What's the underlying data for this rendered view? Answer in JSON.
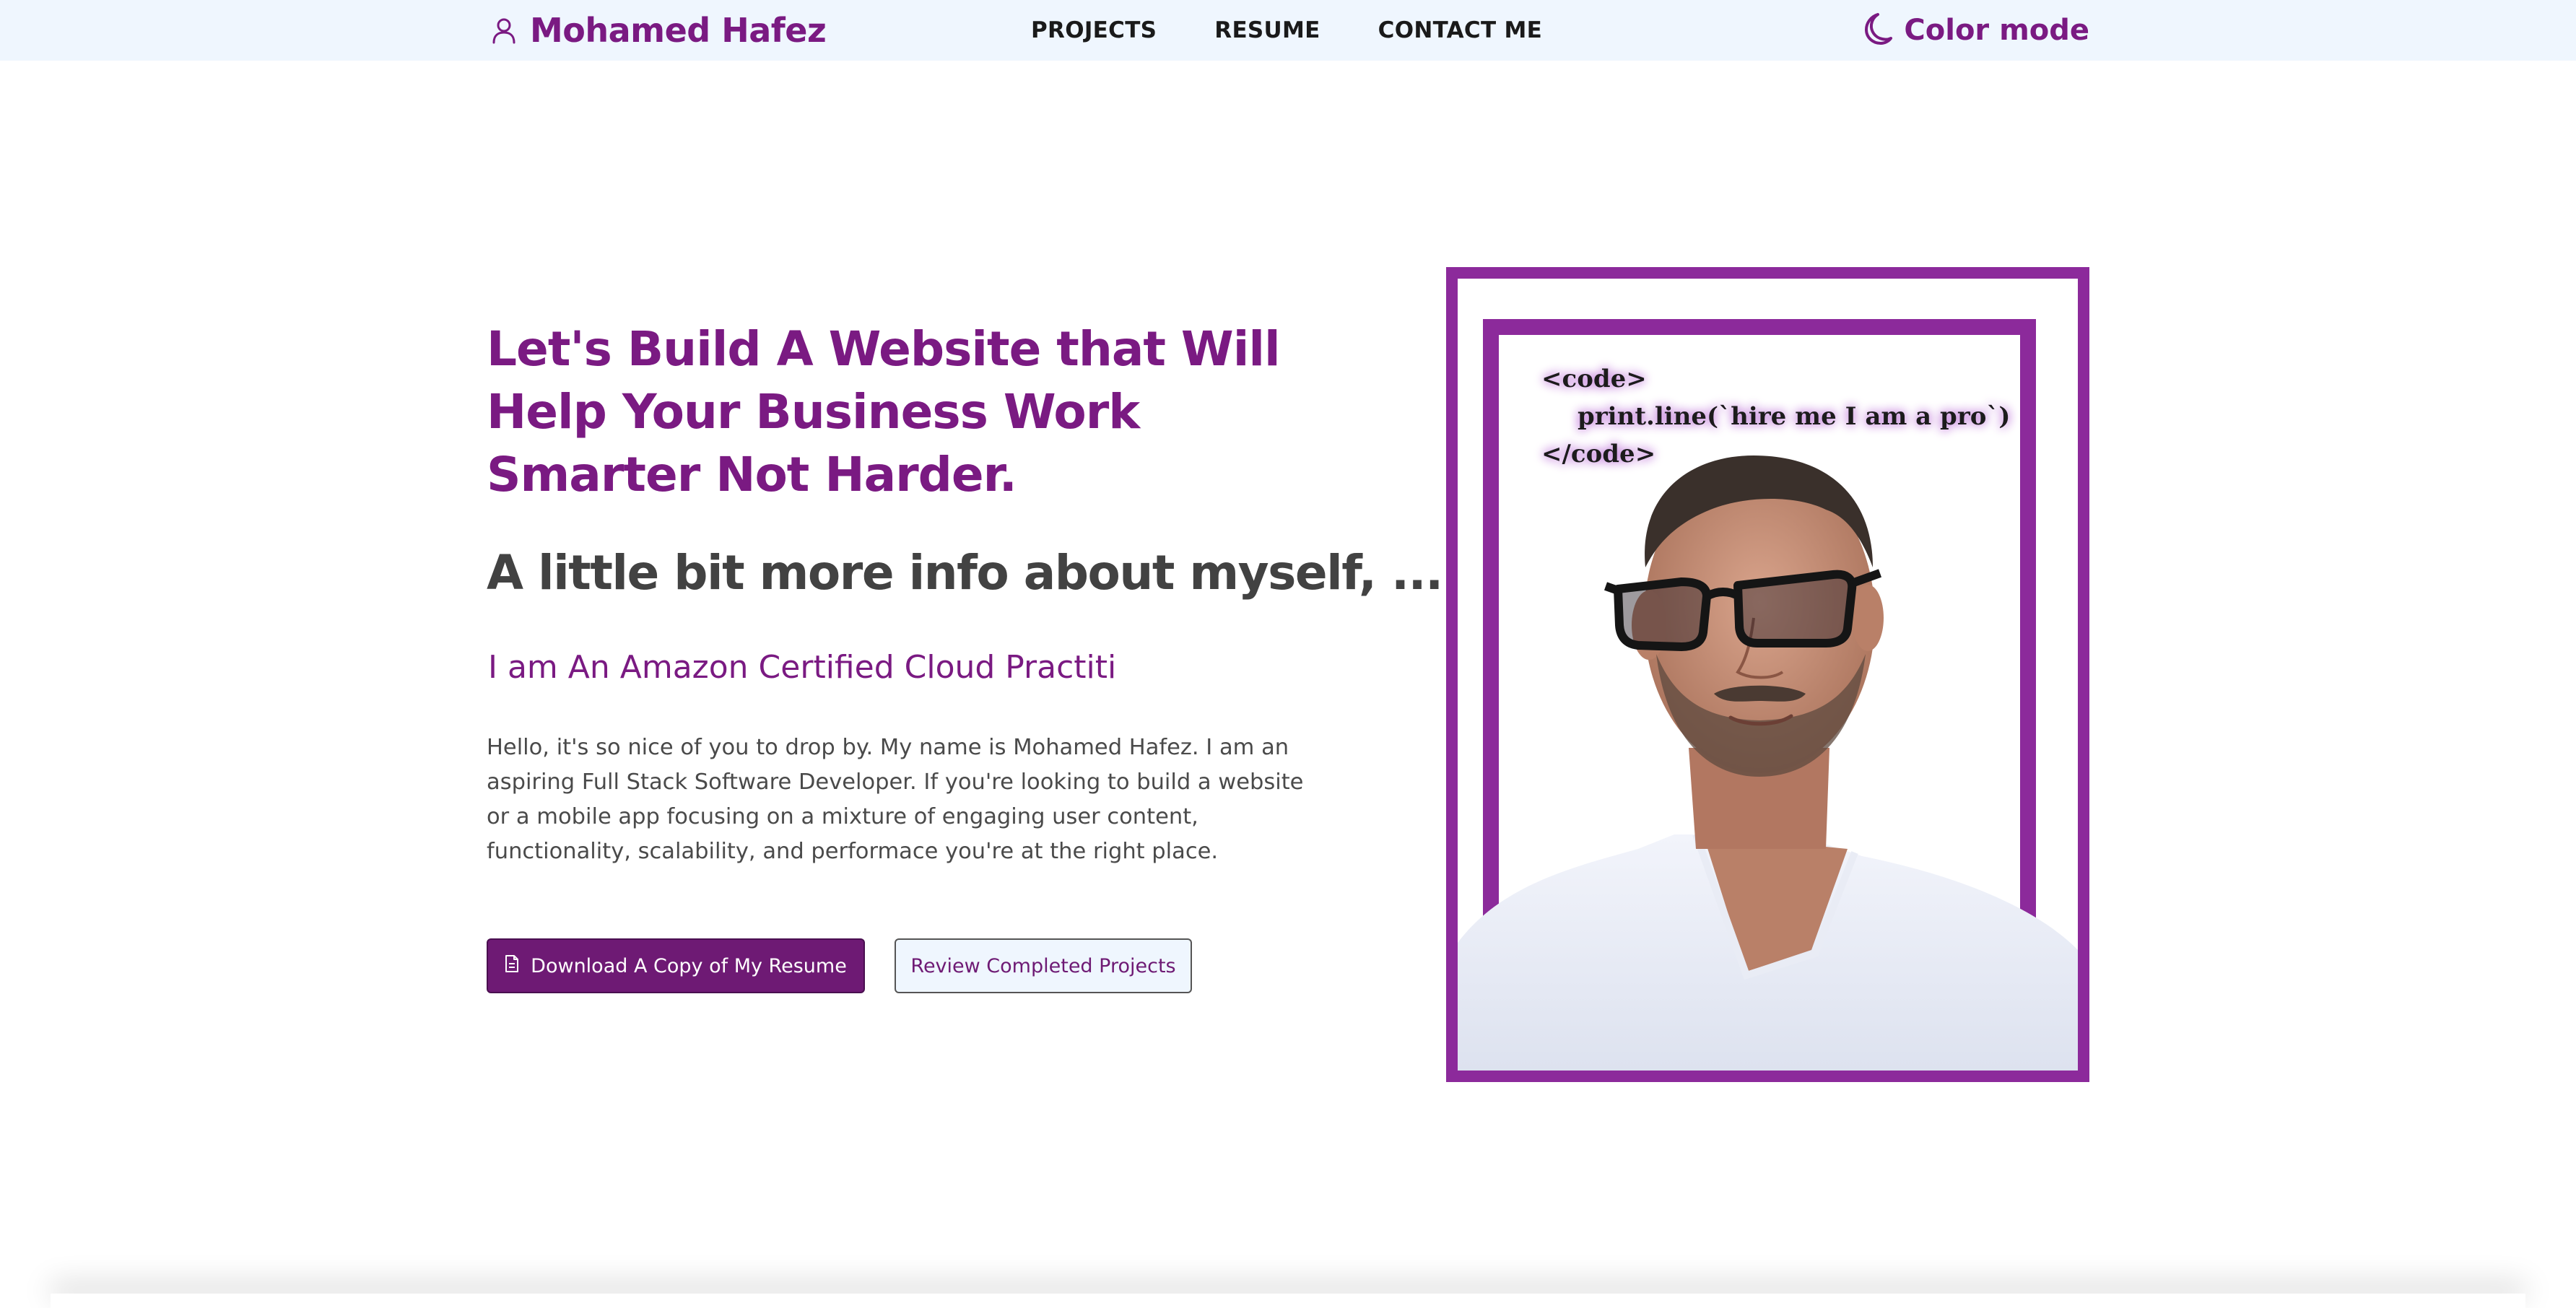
{
  "nav": {
    "brand_name": "Mohamed Hafez",
    "brand_icon": "user-icon",
    "links": [
      {
        "label": "PROJECTS"
      },
      {
        "label": "RESUME"
      },
      {
        "label": "CONTACT ME"
      }
    ],
    "color_mode_label": "Color mode",
    "color_mode_icon": "moon-icon"
  },
  "hero": {
    "title": "Let's Build A Website that Will Help Your Business Work Smarter Not Harder.",
    "subtitle": "A little bit more info about myself, ...",
    "typed_text": "I am An Amazon Certified Cloud Practiti",
    "intro": "Hello, it's so nice of you to drop by. My name is Mohamed Hafez. I am an aspiring Full Stack Software Developer. If you're looking to build a website or a mobile app focusing on a mixture of engaging user content, functionality, scalability, and performace you're at the right place."
  },
  "buttons": {
    "download_resume": "Download A Copy of My Resume",
    "download_icon": "document-icon",
    "review_projects": "Review Completed Projects"
  },
  "portrait": {
    "code_lines": [
      "<code>",
      "print.line(`hire me I am a pro`)",
      "</code>"
    ]
  },
  "colors": {
    "accent": "#7a1a82",
    "nav_background": "#eff6fe",
    "frame": "#8c2a9b",
    "heading_gray": "#424242"
  }
}
